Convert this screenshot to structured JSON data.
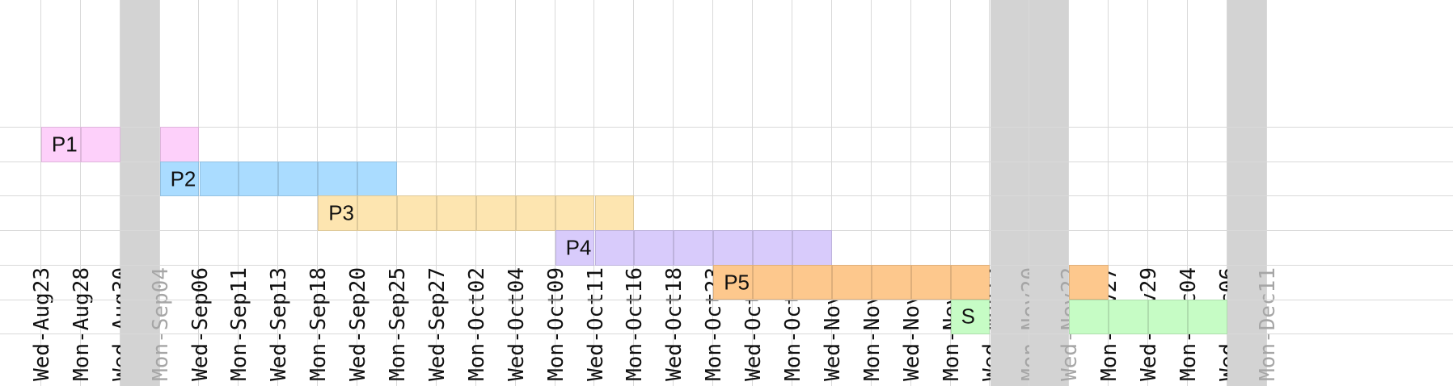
{
  "dates": [
    {
      "label": "Wed-Aug23",
      "holiday": false
    },
    {
      "label": "Mon-Aug28",
      "holiday": false
    },
    {
      "label": "Wed-Aug30",
      "holiday": false
    },
    {
      "label": "Mon-Sep04",
      "holiday": true
    },
    {
      "label": "Wed-Sep06",
      "holiday": false
    },
    {
      "label": "Mon-Sep11",
      "holiday": false
    },
    {
      "label": "Wed-Sep13",
      "holiday": false
    },
    {
      "label": "Mon-Sep18",
      "holiday": false
    },
    {
      "label": "Wed-Sep20",
      "holiday": false
    },
    {
      "label": "Mon-Sep25",
      "holiday": false
    },
    {
      "label": "Wed-Sep27",
      "holiday": false
    },
    {
      "label": "Mon-Oct02",
      "holiday": false
    },
    {
      "label": "Wed-Oct04",
      "holiday": false
    },
    {
      "label": "Mon-Oct09",
      "holiday": false
    },
    {
      "label": "Wed-Oct11",
      "holiday": false
    },
    {
      "label": "Mon-Oct16",
      "holiday": false
    },
    {
      "label": "Wed-Oct18",
      "holiday": false
    },
    {
      "label": "Mon-Oct23",
      "holiday": false
    },
    {
      "label": "Wed-Oct25",
      "holiday": false
    },
    {
      "label": "Mon-Oct30",
      "holiday": false
    },
    {
      "label": "Wed-Nov01",
      "holiday": false
    },
    {
      "label": "Mon-Nov06",
      "holiday": false
    },
    {
      "label": "Wed-Nov08",
      "holiday": false
    },
    {
      "label": "Mon-Nov13",
      "holiday": false
    },
    {
      "label": "Wed-Nov15",
      "holiday": false
    },
    {
      "label": "Mon-Nov20",
      "holiday": true
    },
    {
      "label": "Wed-Nov22",
      "holiday": true
    },
    {
      "label": "Mon-Nov27",
      "holiday": false
    },
    {
      "label": "Wed-Nov29",
      "holiday": false
    },
    {
      "label": "Mon-Dec04",
      "holiday": false
    },
    {
      "label": "Wed-Dec06",
      "holiday": false
    },
    {
      "label": "Mon-Dec11",
      "holiday": true
    }
  ],
  "phases": [
    {
      "label": "P1",
      "color": "#fdd0fa",
      "first": 1,
      "cells": [
        1,
        2,
        4
      ]
    },
    {
      "label": "P2",
      "color": "#aadcff",
      "first": 4,
      "cells": [
        4,
        5,
        6,
        7,
        8,
        9
      ]
    },
    {
      "label": "P3",
      "color": "#fde5b0",
      "first": 8,
      "cells": [
        8,
        9,
        10,
        11,
        12,
        13,
        14,
        15
      ]
    },
    {
      "label": "P4",
      "color": "#d8cbfb",
      "first": 14,
      "cells": [
        14,
        15,
        16,
        17,
        18,
        19,
        20
      ]
    },
    {
      "label": "P5",
      "color": "#fdc88d",
      "first": 18,
      "cells": [
        18,
        19,
        20,
        21,
        22,
        23,
        24,
        27
      ]
    },
    {
      "label": "S",
      "color": "#c6fcc5",
      "first": 24,
      "cells": [
        24,
        27,
        28,
        29,
        30
      ]
    }
  ]
}
